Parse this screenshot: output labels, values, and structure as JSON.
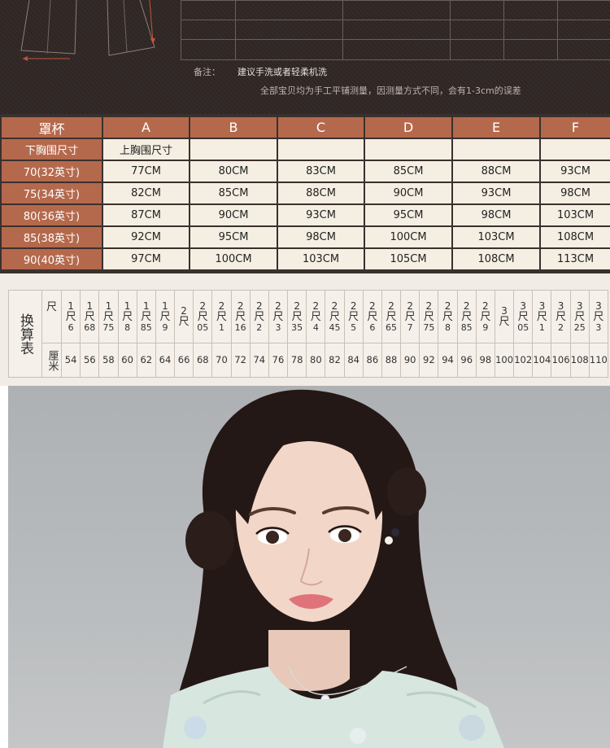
{
  "notes": {
    "label": "备注：",
    "wash": "建议手洗或者轻柔机洗",
    "measurement": "全部宝贝均为手工平铺测量，因测量方式不同，会有1-3cm的误差"
  },
  "size_table": {
    "corner_header": "罩杯",
    "cups": [
      "A",
      "B",
      "C",
      "D",
      "E",
      "F"
    ],
    "underbust_header": "下胸围尺寸",
    "bust_header": "上胸围尺寸",
    "rows": [
      {
        "label": "70(32英寸)",
        "values": [
          "77CM",
          "80CM",
          "83CM",
          "85CM",
          "88CM",
          "93CM"
        ]
      },
      {
        "label": "75(34英寸)",
        "values": [
          "82CM",
          "85CM",
          "88CM",
          "90CM",
          "93CM",
          "98CM"
        ]
      },
      {
        "label": "80(36英寸)",
        "values": [
          "87CM",
          "90CM",
          "93CM",
          "95CM",
          "98CM",
          "103CM"
        ]
      },
      {
        "label": "85(38英寸)",
        "values": [
          "92CM",
          "95CM",
          "98CM",
          "100CM",
          "103CM",
          "108CM"
        ]
      },
      {
        "label": "90(40英寸)",
        "values": [
          "97CM",
          "100CM",
          "103CM",
          "105CM",
          "108CM",
          "113CM"
        ]
      }
    ]
  },
  "conversion": {
    "title": "换算表",
    "chi_label": "尺",
    "cm_label": "厘米",
    "chi": [
      {
        "top": "1",
        "unit": "尺",
        "bottom": "6"
      },
      {
        "top": "1",
        "unit": "尺",
        "bottom": "68"
      },
      {
        "top": "1",
        "unit": "尺",
        "bottom": "75"
      },
      {
        "top": "1",
        "unit": "尺",
        "bottom": "8"
      },
      {
        "top": "1",
        "unit": "尺",
        "bottom": "85"
      },
      {
        "top": "1",
        "unit": "尺",
        "bottom": "9"
      },
      {
        "top": "2",
        "unit": "尺",
        "bottom": ""
      },
      {
        "top": "2",
        "unit": "尺",
        "bottom": "05"
      },
      {
        "top": "2",
        "unit": "尺",
        "bottom": "1"
      },
      {
        "top": "2",
        "unit": "尺",
        "bottom": "16"
      },
      {
        "top": "2",
        "unit": "尺",
        "bottom": "2"
      },
      {
        "top": "2",
        "unit": "尺",
        "bottom": "3"
      },
      {
        "top": "2",
        "unit": "尺",
        "bottom": "35"
      },
      {
        "top": "2",
        "unit": "尺",
        "bottom": "4"
      },
      {
        "top": "2",
        "unit": "尺",
        "bottom": "45"
      },
      {
        "top": "2",
        "unit": "尺",
        "bottom": "5"
      },
      {
        "top": "2",
        "unit": "尺",
        "bottom": "6"
      },
      {
        "top": "2",
        "unit": "尺",
        "bottom": "65"
      },
      {
        "top": "2",
        "unit": "尺",
        "bottom": "7"
      },
      {
        "top": "2",
        "unit": "尺",
        "bottom": "75"
      },
      {
        "top": "2",
        "unit": "尺",
        "bottom": "8"
      },
      {
        "top": "2",
        "unit": "尺",
        "bottom": "85"
      },
      {
        "top": "2",
        "unit": "尺",
        "bottom": "9"
      },
      {
        "top": "3",
        "unit": "尺",
        "bottom": ""
      },
      {
        "top": "3",
        "unit": "尺",
        "bottom": "05"
      },
      {
        "top": "3",
        "unit": "尺",
        "bottom": "1"
      },
      {
        "top": "3",
        "unit": "尺",
        "bottom": "2"
      },
      {
        "top": "3",
        "unit": "尺",
        "bottom": "25"
      },
      {
        "top": "3",
        "unit": "尺",
        "bottom": "3"
      }
    ],
    "cm": [
      "54",
      "56",
      "58",
      "60",
      "62",
      "64",
      "66",
      "68",
      "70",
      "72",
      "74",
      "76",
      "78",
      "80",
      "82",
      "84",
      "86",
      "88",
      "90",
      "92",
      "94",
      "96",
      "98",
      "100",
      "102",
      "104",
      "106",
      "108",
      "110"
    ]
  },
  "colors": {
    "header_brown": "#b5694c",
    "cell_cream": "#f5efe3",
    "banner_dark": "#2e2624"
  }
}
